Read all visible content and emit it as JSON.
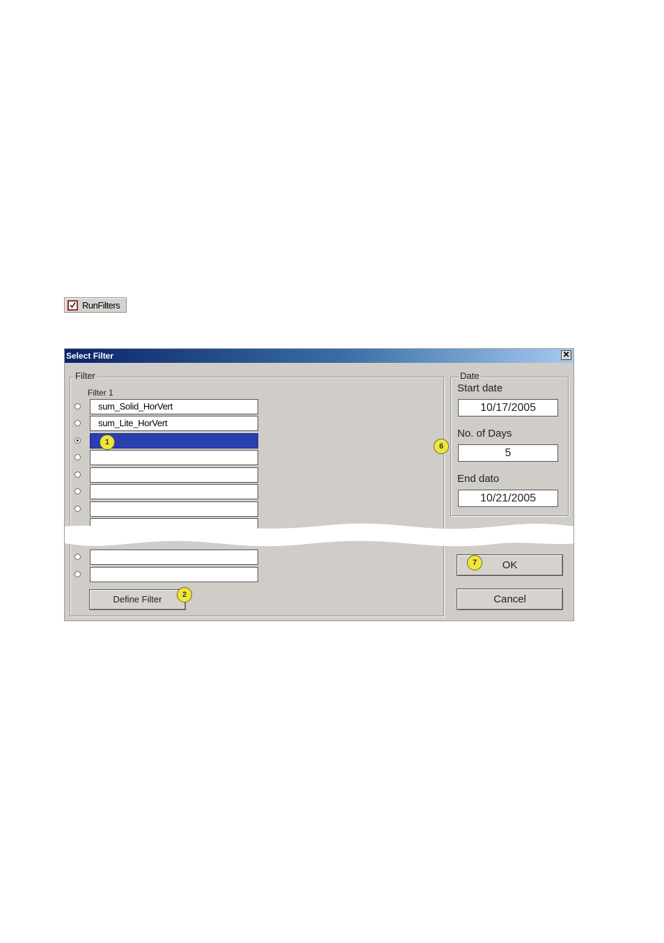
{
  "toolbar": {
    "run_filters_label": "RunFilters"
  },
  "dialog": {
    "title": "Select Filter",
    "close_glyph": "✕",
    "filter_group": {
      "legend": "Filter",
      "column_label": "Filter 1",
      "rows": [
        {
          "value": "sum_Solid_HorVert",
          "checked": false,
          "selected": false
        },
        {
          "value": "sum_Lite_HorVert",
          "checked": false,
          "selected": false
        },
        {
          "value": "",
          "checked": true,
          "selected": true
        },
        {
          "value": "",
          "checked": false,
          "selected": false
        },
        {
          "value": "",
          "checked": false,
          "selected": false
        },
        {
          "value": "",
          "checked": false,
          "selected": false
        },
        {
          "value": "",
          "checked": false,
          "selected": false
        }
      ],
      "rows_after_break": [
        {
          "value": "",
          "checked": false
        },
        {
          "value": "",
          "checked": false
        }
      ],
      "define_filter_label": "Define Filter"
    },
    "date_group": {
      "legend": "Date",
      "start_label": "Start date",
      "start_value": "10/17/2005",
      "days_label": "No. of Days",
      "days_value": "5",
      "end_label": "End dato",
      "end_value": "10/21/2005"
    },
    "ok_label": "OK",
    "cancel_label": "Cancel"
  },
  "callouts": {
    "c1": "1",
    "c2": "2",
    "c6": "6",
    "c7": "7"
  },
  "colors": {
    "title_gradient_start": "#0a246a",
    "selection": "#2a3fb0",
    "callout": "#f0e63a",
    "dialog_face": "#d0cdc8"
  }
}
